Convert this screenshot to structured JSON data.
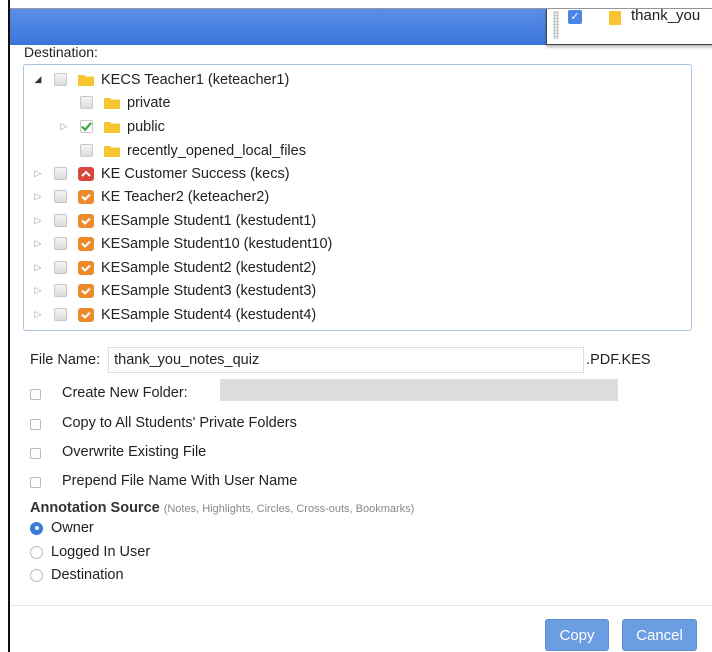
{
  "dragged_item": {
    "label": "thank_you"
  },
  "destination": {
    "label": "Destination:",
    "tree": [
      {
        "label": "KECS Teacher1 (keteacher1)",
        "expander": "open",
        "checked": false,
        "icon": "folder-yellow",
        "depth": 0
      },
      {
        "label": "private",
        "expander": "none",
        "checked": false,
        "icon": "folder-yellow",
        "depth": 1
      },
      {
        "label": "public",
        "expander": "closed",
        "checked": true,
        "icon": "folder-yellow",
        "depth": 1
      },
      {
        "label": "recently_opened_local_files",
        "expander": "none",
        "checked": false,
        "icon": "folder-yellow",
        "depth": 1
      },
      {
        "label": "KE Customer Success (kecs)",
        "expander": "closed",
        "checked": false,
        "icon": "user-folder-red",
        "depth": 0
      },
      {
        "label": "KE Teacher2 (keteacher2)",
        "expander": "closed",
        "checked": false,
        "icon": "user-folder-orange",
        "depth": 0
      },
      {
        "label": "KESample Student1 (kestudent1)",
        "expander": "closed",
        "checked": false,
        "icon": "user-folder-orange",
        "depth": 0
      },
      {
        "label": "KESample Student10 (kestudent10)",
        "expander": "closed",
        "checked": false,
        "icon": "user-folder-orange",
        "depth": 0
      },
      {
        "label": "KESample Student2 (kestudent2)",
        "expander": "closed",
        "checked": false,
        "icon": "user-folder-orange",
        "depth": 0
      },
      {
        "label": "KESample Student3 (kestudent3)",
        "expander": "closed",
        "checked": false,
        "icon": "user-folder-orange",
        "depth": 0
      },
      {
        "label": "KESample Student4 (kestudent4)",
        "expander": "closed",
        "checked": false,
        "icon": "user-folder-orange",
        "depth": 0
      }
    ]
  },
  "file_name": {
    "label": "File Name:",
    "value": "thank_you_notes_quiz",
    "extension": ".PDF.KES"
  },
  "options": {
    "create_new_folder": {
      "label": "Create New Folder:",
      "checked": false,
      "value": ""
    },
    "copy_to_private": {
      "label": "Copy to All Students' Private Folders",
      "checked": false
    },
    "overwrite": {
      "label": "Overwrite Existing File",
      "checked": false
    },
    "prepend": {
      "label": "Prepend File Name With User Name",
      "checked": false
    }
  },
  "annotation": {
    "title": "Annotation Source",
    "note": "(Notes, Highlights, Circles, Cross-outs, Bookmarks)",
    "choices": [
      {
        "label": "Owner",
        "selected": true
      },
      {
        "label": "Logged In User",
        "selected": false
      },
      {
        "label": "Destination",
        "selected": false
      }
    ]
  },
  "buttons": {
    "copy": "Copy",
    "cancel": "Cancel"
  },
  "colors": {
    "titlebar": "#3b76db",
    "button": "#6a9de2",
    "checkmark": "#3aa83a",
    "folder": "#f7c531"
  }
}
